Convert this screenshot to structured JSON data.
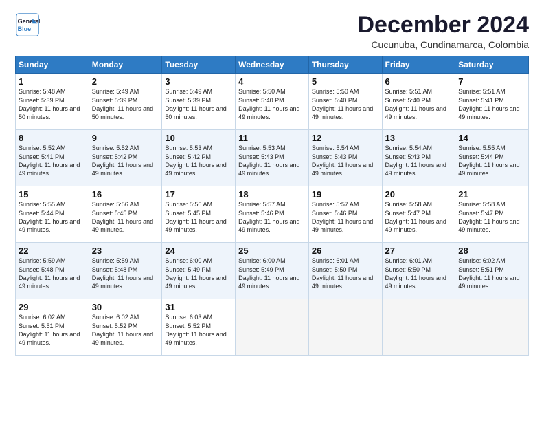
{
  "logo": {
    "line1": "General",
    "line2": "Blue"
  },
  "title": "December 2024",
  "subtitle": "Cucunuba, Cundinamarca, Colombia",
  "days_of_week": [
    "Sunday",
    "Monday",
    "Tuesday",
    "Wednesday",
    "Thursday",
    "Friday",
    "Saturday"
  ],
  "weeks": [
    [
      {
        "day": "1",
        "sunrise": "5:48 AM",
        "sunset": "5:39 PM",
        "daylight": "11 hours and 50 minutes."
      },
      {
        "day": "2",
        "sunrise": "5:49 AM",
        "sunset": "5:39 PM",
        "daylight": "11 hours and 50 minutes."
      },
      {
        "day": "3",
        "sunrise": "5:49 AM",
        "sunset": "5:39 PM",
        "daylight": "11 hours and 50 minutes."
      },
      {
        "day": "4",
        "sunrise": "5:50 AM",
        "sunset": "5:40 PM",
        "daylight": "11 hours and 49 minutes."
      },
      {
        "day": "5",
        "sunrise": "5:50 AM",
        "sunset": "5:40 PM",
        "daylight": "11 hours and 49 minutes."
      },
      {
        "day": "6",
        "sunrise": "5:51 AM",
        "sunset": "5:40 PM",
        "daylight": "11 hours and 49 minutes."
      },
      {
        "day": "7",
        "sunrise": "5:51 AM",
        "sunset": "5:41 PM",
        "daylight": "11 hours and 49 minutes."
      }
    ],
    [
      {
        "day": "8",
        "sunrise": "5:52 AM",
        "sunset": "5:41 PM",
        "daylight": "11 hours and 49 minutes."
      },
      {
        "day": "9",
        "sunrise": "5:52 AM",
        "sunset": "5:42 PM",
        "daylight": "11 hours and 49 minutes."
      },
      {
        "day": "10",
        "sunrise": "5:53 AM",
        "sunset": "5:42 PM",
        "daylight": "11 hours and 49 minutes."
      },
      {
        "day": "11",
        "sunrise": "5:53 AM",
        "sunset": "5:43 PM",
        "daylight": "11 hours and 49 minutes."
      },
      {
        "day": "12",
        "sunrise": "5:54 AM",
        "sunset": "5:43 PM",
        "daylight": "11 hours and 49 minutes."
      },
      {
        "day": "13",
        "sunrise": "5:54 AM",
        "sunset": "5:43 PM",
        "daylight": "11 hours and 49 minutes."
      },
      {
        "day": "14",
        "sunrise": "5:55 AM",
        "sunset": "5:44 PM",
        "daylight": "11 hours and 49 minutes."
      }
    ],
    [
      {
        "day": "15",
        "sunrise": "5:55 AM",
        "sunset": "5:44 PM",
        "daylight": "11 hours and 49 minutes."
      },
      {
        "day": "16",
        "sunrise": "5:56 AM",
        "sunset": "5:45 PM",
        "daylight": "11 hours and 49 minutes."
      },
      {
        "day": "17",
        "sunrise": "5:56 AM",
        "sunset": "5:45 PM",
        "daylight": "11 hours and 49 minutes."
      },
      {
        "day": "18",
        "sunrise": "5:57 AM",
        "sunset": "5:46 PM",
        "daylight": "11 hours and 49 minutes."
      },
      {
        "day": "19",
        "sunrise": "5:57 AM",
        "sunset": "5:46 PM",
        "daylight": "11 hours and 49 minutes."
      },
      {
        "day": "20",
        "sunrise": "5:58 AM",
        "sunset": "5:47 PM",
        "daylight": "11 hours and 49 minutes."
      },
      {
        "day": "21",
        "sunrise": "5:58 AM",
        "sunset": "5:47 PM",
        "daylight": "11 hours and 49 minutes."
      }
    ],
    [
      {
        "day": "22",
        "sunrise": "5:59 AM",
        "sunset": "5:48 PM",
        "daylight": "11 hours and 49 minutes."
      },
      {
        "day": "23",
        "sunrise": "5:59 AM",
        "sunset": "5:48 PM",
        "daylight": "11 hours and 49 minutes."
      },
      {
        "day": "24",
        "sunrise": "6:00 AM",
        "sunset": "5:49 PM",
        "daylight": "11 hours and 49 minutes."
      },
      {
        "day": "25",
        "sunrise": "6:00 AM",
        "sunset": "5:49 PM",
        "daylight": "11 hours and 49 minutes."
      },
      {
        "day": "26",
        "sunrise": "6:01 AM",
        "sunset": "5:50 PM",
        "daylight": "11 hours and 49 minutes."
      },
      {
        "day": "27",
        "sunrise": "6:01 AM",
        "sunset": "5:50 PM",
        "daylight": "11 hours and 49 minutes."
      },
      {
        "day": "28",
        "sunrise": "6:02 AM",
        "sunset": "5:51 PM",
        "daylight": "11 hours and 49 minutes."
      }
    ],
    [
      {
        "day": "29",
        "sunrise": "6:02 AM",
        "sunset": "5:51 PM",
        "daylight": "11 hours and 49 minutes."
      },
      {
        "day": "30",
        "sunrise": "6:02 AM",
        "sunset": "5:52 PM",
        "daylight": "11 hours and 49 minutes."
      },
      {
        "day": "31",
        "sunrise": "6:03 AM",
        "sunset": "5:52 PM",
        "daylight": "11 hours and 49 minutes."
      },
      null,
      null,
      null,
      null
    ]
  ]
}
